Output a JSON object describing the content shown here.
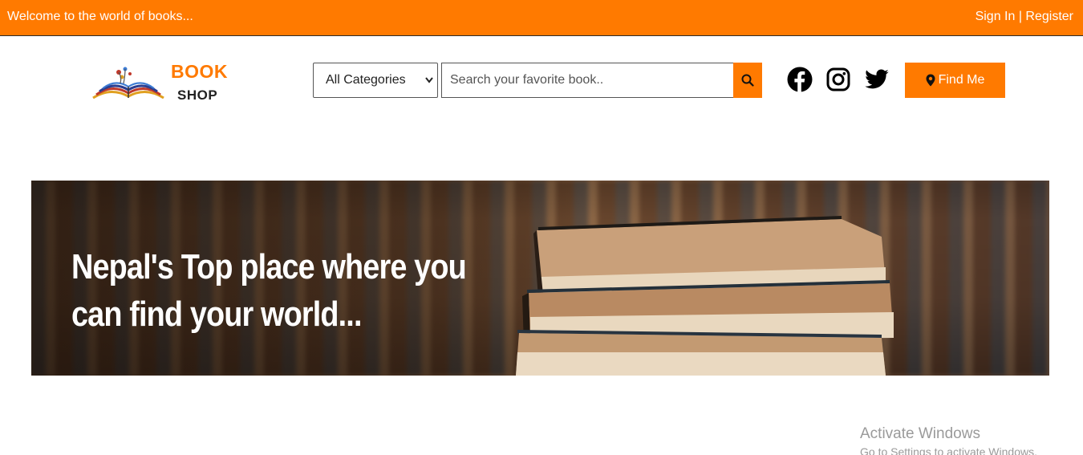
{
  "topbar": {
    "welcome": "Welcome to the world of books...",
    "sign_in": "Sign In",
    "separator": " | ",
    "register": "Register",
    "bg_color": "#ff7a00"
  },
  "logo": {
    "line1": "BOOK",
    "line2": "SHOP",
    "icon": "open-book-icon"
  },
  "search": {
    "category_selected": "All Categories",
    "placeholder": "Search your favorite book..",
    "value": "",
    "button_icon": "search-icon"
  },
  "social": {
    "icons": [
      "facebook-icon",
      "instagram-icon",
      "twitter-icon"
    ]
  },
  "find_me": {
    "label": "Find Me",
    "icon": "map-marker-icon"
  },
  "banner": {
    "headline": "Nepal's Top place where you can find your world..."
  },
  "watermark": {
    "title": "Activate Windows",
    "subtitle": "Go to Settings to activate Windows."
  },
  "colors": {
    "accent": "#ff7a00",
    "text_dark": "#222222"
  }
}
